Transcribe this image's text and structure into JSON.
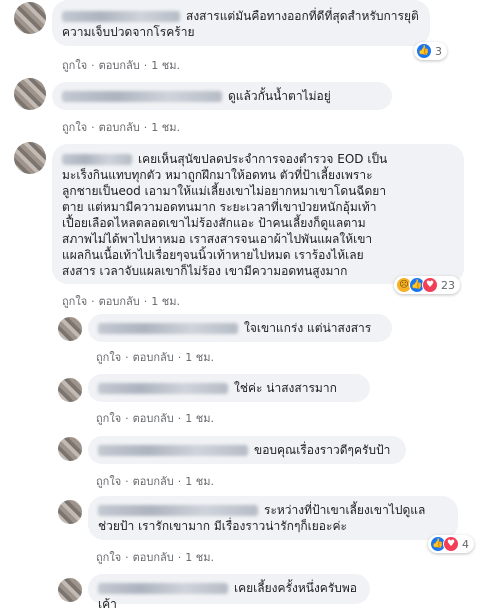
{
  "comments": [
    {
      "id": "c1",
      "text_lines": [
        "สงสารแต่มันคือทางออกที่ดีที่สุดสำหรับการยุติ",
        "ความเจ็บปวดจากโรคร้าย"
      ],
      "actions": {
        "like": "ถูกใจ",
        "reply": "ตอบกลับ",
        "time": "1 ชม."
      },
      "reactions": {
        "count": "3",
        "icons": [
          "like-icon"
        ]
      }
    },
    {
      "id": "c2",
      "text_lines": [
        "ดูแล้วกั้นน้ำตาไม่อยู่"
      ],
      "actions": {
        "like": "ถูกใจ",
        "reply": "ตอบกลับ",
        "time": "1 ชม."
      }
    },
    {
      "id": "c3",
      "text_lines": [
        "เคยเห็นสุนัขปลดประจำการจองตำรวจ EOD เป็น",
        "มะเร็งกินแทบทุกตัว หมาถูกฝึกมาให้อดทน ตัวที่ป้าเลี้ยงเพราะ",
        "ลูกชายเป็นeod เอามาให้แม่เลี้ยงเขาไม่อยากหมาเขาโดนฉีดยา",
        "ตาย แต่หมามีความอดทนมาก ระยะเวลาที่เขาป่วยหนักอุ้มเท้า",
        "เปื้อยเลือดไหลตลอดเขาไม่ร้องสักแอะ ป้าคนเลี้ยงก็ดูแลตาม",
        "สภาพไม่ได้พาไปหาหมอ เราสงสารจนเอาผ้าไปพันแผลให้เขา",
        "แผลกินเนื้อเท้าไปเรื่อยๆจนนิ้วเท้าหายไปหมด เราร้องไห้เลย",
        "สงสาร เวลาจับแผลเขาก็ไม่ร้อง เขามีความอดทนสูงมาก"
      ],
      "actions": {
        "like": "ถูกใจ",
        "reply": "ตอบกลับ",
        "time": "1 ชม."
      },
      "reactions": {
        "count": "23",
        "icons": [
          "sad-icon",
          "like-icon",
          "love-icon"
        ]
      }
    },
    {
      "id": "r1",
      "text_lines": [
        "ใจเขาแกร่ง แต่น่าสงสาร"
      ],
      "actions": {
        "like": "ถูกใจ",
        "reply": "ตอบกลับ",
        "time": "1 ชม."
      }
    },
    {
      "id": "r2",
      "text_lines": [
        "ใช่ค่ะ น่าสงสารมาก"
      ],
      "actions": {
        "like": "ถูกใจ",
        "reply": "ตอบกลับ",
        "time": "1 ชม."
      }
    },
    {
      "id": "r3",
      "text_lines": [
        "ขอบคุณเรื่องราวดีๆครับป้า"
      ],
      "actions": {
        "like": "ถูกใจ",
        "reply": "ตอบกลับ",
        "time": "1 ชม."
      }
    },
    {
      "id": "r4",
      "text_lines": [
        "ระหว่างที่ป้าเขาเลี้ยงเขาไปดูแล",
        "ช่วยป้า เรารักเขามาก มีเรื่องราวน่ารักๆก็เยอะค่ะ"
      ],
      "actions": {
        "like": "ถูกใจ",
        "reply": "ตอบกลับ",
        "time": "1 ชม."
      },
      "reactions": {
        "count": "4",
        "icons": [
          "like-icon",
          "love-icon"
        ]
      }
    },
    {
      "id": "r5",
      "text_lines": [
        "เคยเลี้ยงครั้งหนึ่งครับพอเค้า"
      ]
    }
  ],
  "colors": {
    "bubble": "#f0f2f5",
    "meta": "#65676b",
    "like": "#1877f2",
    "love": "#f33e58",
    "sad": "#f7b125"
  }
}
